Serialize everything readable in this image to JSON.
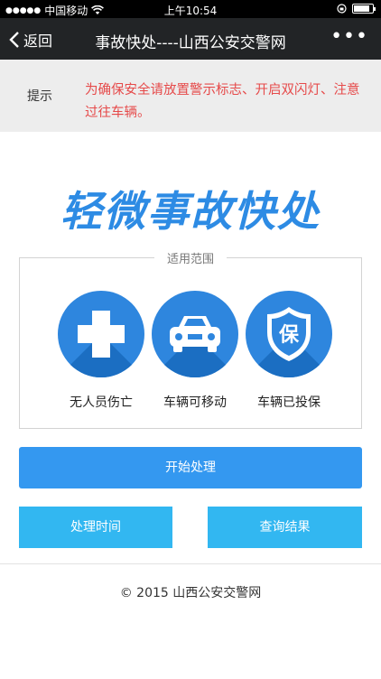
{
  "status_bar": {
    "signal_dots": "●●●●●",
    "carrier": "中国移动",
    "time": "上午10:54",
    "battery_level": 0.85
  },
  "nav": {
    "back_label": "返回",
    "title": "事故快处----山西公安交警网",
    "more_label": "•••"
  },
  "tip": {
    "label": "提示",
    "text": "为确保安全请放置警示标志、开启双闪灯、注意过往车辆。"
  },
  "headline": "轻微事故快处",
  "scope": {
    "title": "适用范围",
    "items": [
      {
        "icon": "medical-cross-icon",
        "label": "无人员伤亡"
      },
      {
        "icon": "car-icon",
        "label": "车辆可移动"
      },
      {
        "icon": "insurance-shield-icon",
        "label": "车辆已投保",
        "glyph": "保"
      }
    ]
  },
  "buttons": {
    "start": "开始处理",
    "time": "处理时间",
    "query": "查询结果"
  },
  "footer": "© 2015 山西公安交警网",
  "colors": {
    "nav_bg": "#222426",
    "tip_text": "#e64a4a",
    "headline": "#2d8be4",
    "icon_bg": "#2e86de",
    "primary_button": "#3498f0",
    "secondary_button": "#32b7f1"
  }
}
